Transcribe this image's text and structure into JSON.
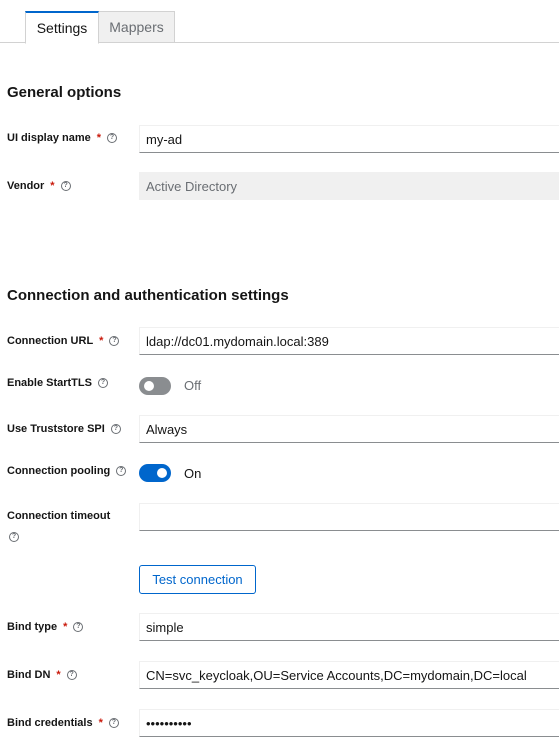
{
  "tabs": [
    {
      "label": "Settings",
      "active": true
    },
    {
      "label": "Mappers",
      "active": false
    }
  ],
  "general": {
    "title": "General options",
    "ui_display_name": {
      "label": "UI display name",
      "value": "my-ad"
    },
    "vendor": {
      "label": "Vendor",
      "value": "Active Directory"
    }
  },
  "connection": {
    "title": "Connection and authentication settings",
    "url": {
      "label": "Connection URL",
      "value": "ldap://dc01.mydomain.local:389"
    },
    "starttls": {
      "label": "Enable StartTLS",
      "state": "Off"
    },
    "truststore": {
      "label": "Use Truststore SPI",
      "value": "Always"
    },
    "pooling": {
      "label": "Connection pooling",
      "state": "On"
    },
    "timeout": {
      "label": "Connection timeout",
      "value": ""
    },
    "test_button": "Test connection",
    "bind_type": {
      "label": "Bind type",
      "value": "simple"
    },
    "bind_dn": {
      "label": "Bind DN",
      "value": "CN=svc_keycloak,OU=Service Accounts,DC=mydomain,DC=local"
    },
    "bind_credentials": {
      "label": "Bind credentials",
      "value": "••••••••••"
    }
  },
  "colors": {
    "accent": "#0066cc",
    "required": "#c9190b",
    "toggle_off": "#8a8d90"
  }
}
